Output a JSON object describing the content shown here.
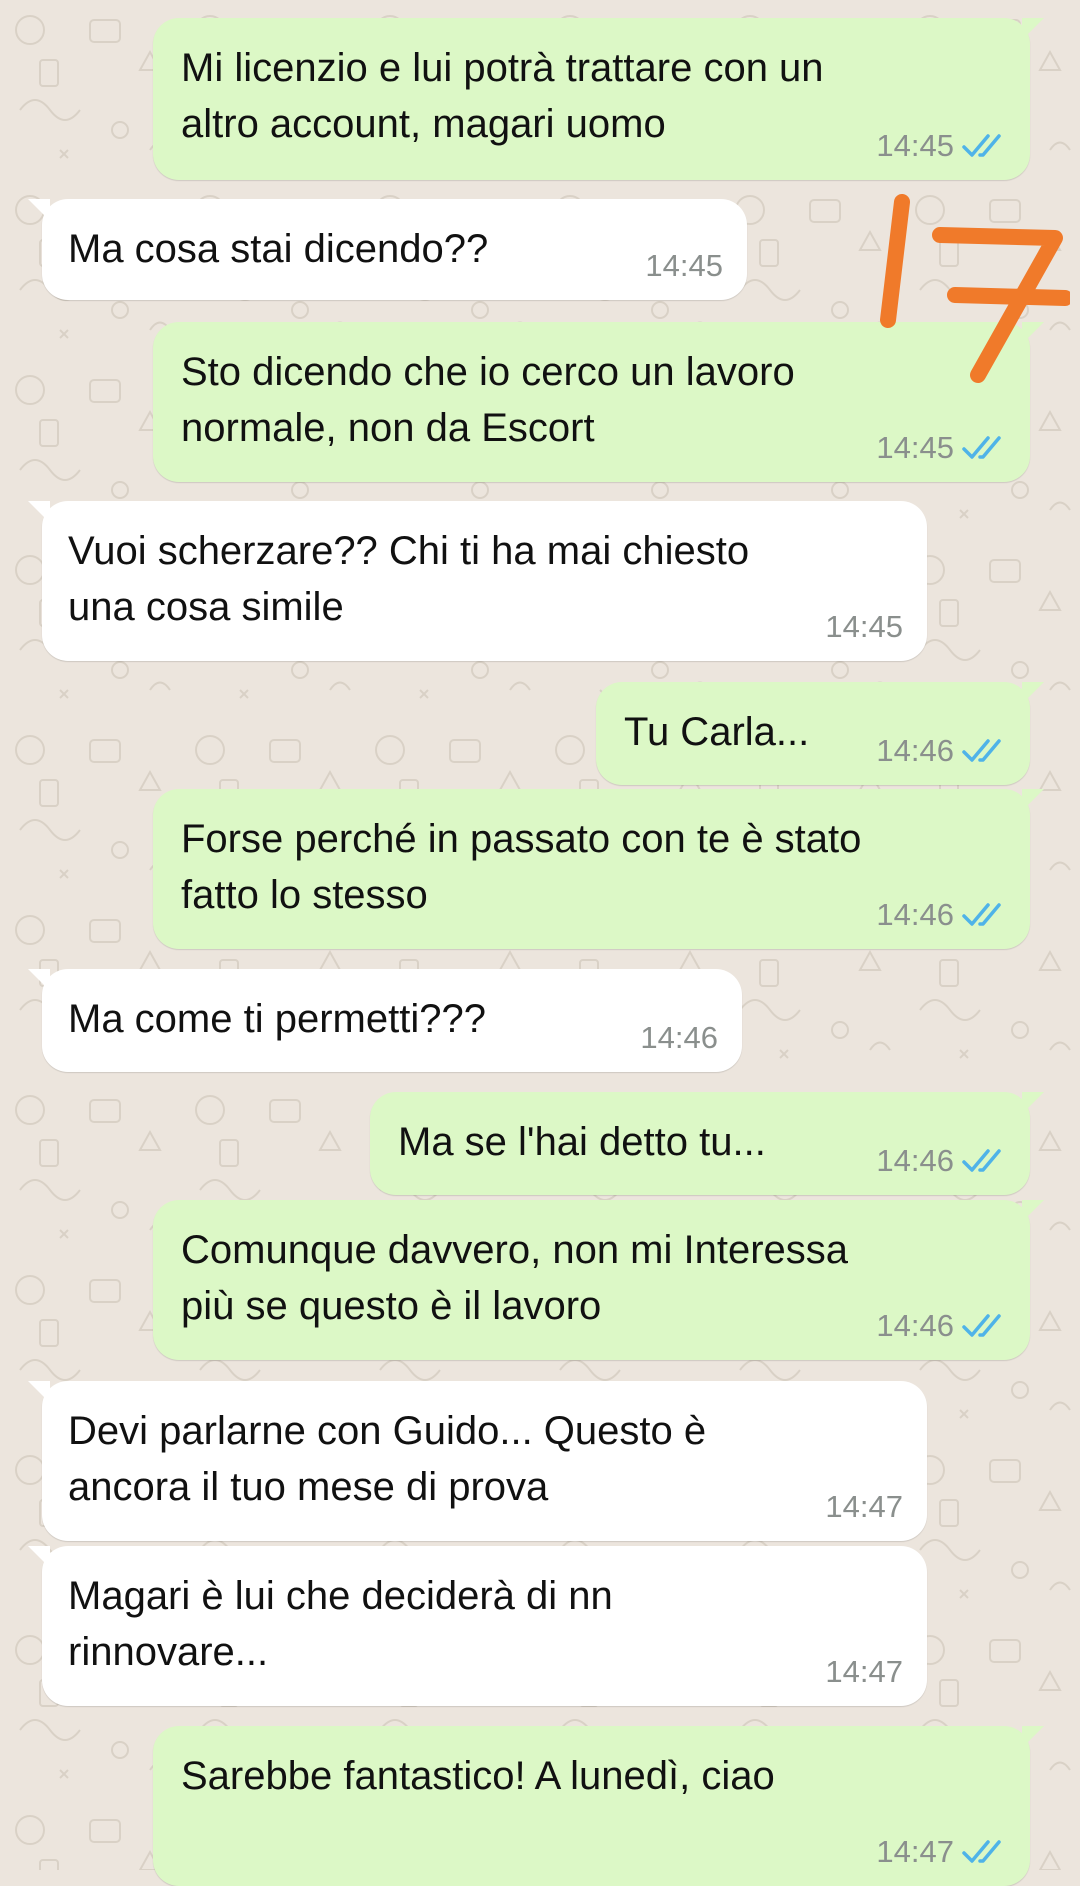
{
  "messages": [
    {
      "text": "Mi licenzio e lui potrà trattare con un\naltro account, magari uomo",
      "time": "14:45",
      "direction": "outgoing",
      "status": "read"
    },
    {
      "text": "Ma cosa stai dicendo??",
      "time": "14:45",
      "direction": "incoming"
    },
    {
      "text": "Sto dicendo che io cerco un lavoro\nnormale, non da Escort",
      "time": "14:45",
      "direction": "outgoing",
      "status": "read"
    },
    {
      "text": "Vuoi scherzare?? Chi ti ha mai chiesto\nuna cosa simile",
      "time": "14:45",
      "direction": "incoming"
    },
    {
      "text": "Tu Carla...",
      "time": "14:46",
      "direction": "outgoing",
      "status": "read"
    },
    {
      "text": "Forse perché in passato con te è stato\nfatto lo stesso",
      "time": "14:46",
      "direction": "outgoing",
      "status": "read"
    },
    {
      "text": "Ma come ti permetti???",
      "time": "14:46",
      "direction": "incoming"
    },
    {
      "text": "Ma se l'hai detto tu...",
      "time": "14:46",
      "direction": "outgoing",
      "status": "read"
    },
    {
      "text": " Comunque davvero, non mi Interessa\npiù se questo è il lavoro",
      "time": "14:46",
      "direction": "outgoing",
      "status": "read"
    },
    {
      "text": "Devi parlarne con Guido... Questo è\nancora il tuo mese di prova",
      "time": "14:47",
      "direction": "incoming"
    },
    {
      "text": "Magari è lui che deciderà di nn\nrinnovare...",
      "time": "14:47",
      "direction": "incoming"
    },
    {
      "text": "Sarebbe fantastico! A lunedì, ciao",
      "time": "14:47",
      "direction": "outgoing",
      "status": "read"
    }
  ],
  "annotation": {
    "text": "17",
    "color": "#f07a2a"
  },
  "colors": {
    "background": "#ece5dd",
    "outgoing_bubble": "#dcf8c6",
    "incoming_bubble": "#ffffff",
    "read_ticks": "#4fb3e8",
    "timestamp": "#8a8f8d"
  },
  "icons": {
    "read_receipt": "double-check-icon"
  }
}
